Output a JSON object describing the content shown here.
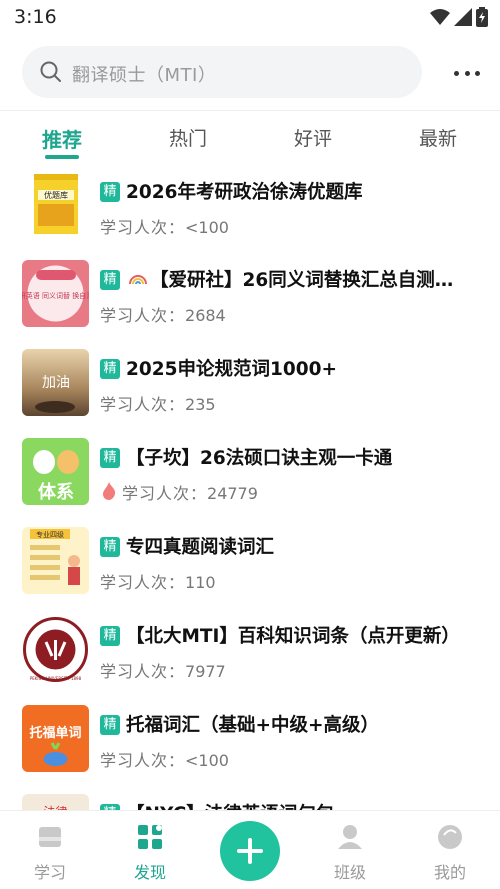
{
  "status_bar": {
    "time": "3:16"
  },
  "search": {
    "placeholder": "翻译硕士（MTI）"
  },
  "tabs": [
    {
      "label": "推荐",
      "active": true
    },
    {
      "label": "热门",
      "active": false
    },
    {
      "label": "好评",
      "active": false
    },
    {
      "label": "最新",
      "active": false
    }
  ],
  "list_label_prefix": "学习人次：",
  "items": [
    {
      "badge": "精",
      "title": "2026年考研政治徐涛优题库",
      "count": "<100",
      "hot": false,
      "thumb_text": "优题库"
    },
    {
      "badge": "精",
      "title": "【爱研社】26同义词替换汇总自测…",
      "count": "2684",
      "hot": false,
      "emoji_prefix": true,
      "thumb_text": "考研英语 同义词替 换自测卡"
    },
    {
      "badge": "精",
      "title": "2025申论规范词1000+",
      "count": "235",
      "hot": false,
      "thumb_text": "加油"
    },
    {
      "badge": "精",
      "title": "【子坎】26法硕口诀主观一卡通",
      "count": "24779",
      "hot": true,
      "thumb_text": "体系"
    },
    {
      "badge": "精",
      "title": "专四真题阅读词汇",
      "count": "110",
      "hot": false,
      "thumb_text": "专业四级"
    },
    {
      "badge": "精",
      "title": "【北大MTI】百科知识词条（点开更新）",
      "count": "7977",
      "hot": false,
      "thumb_text": "PEKING UNIVERSITY 1898"
    },
    {
      "badge": "精",
      "title": "托福词汇（基础+中级+高级）",
      "count": "<100",
      "hot": false,
      "thumb_text": "托福单词"
    },
    {
      "badge": "精",
      "title": "【NYC】法律英语词句包",
      "count": "",
      "hot": false,
      "thumb_text": "法律"
    }
  ],
  "bottom_nav": [
    {
      "label": "学习",
      "icon": "book-icon",
      "active": false
    },
    {
      "label": "发现",
      "icon": "discover-icon",
      "active": true
    },
    {
      "label": "",
      "icon": "plus-icon",
      "active": false
    },
    {
      "label": "班级",
      "icon": "class-icon",
      "active": false
    },
    {
      "label": "我的",
      "icon": "profile-icon",
      "active": false
    }
  ],
  "colors": {
    "accent": "#1ea68f",
    "badge": "#1fb89b",
    "fab": "#21c29e"
  }
}
